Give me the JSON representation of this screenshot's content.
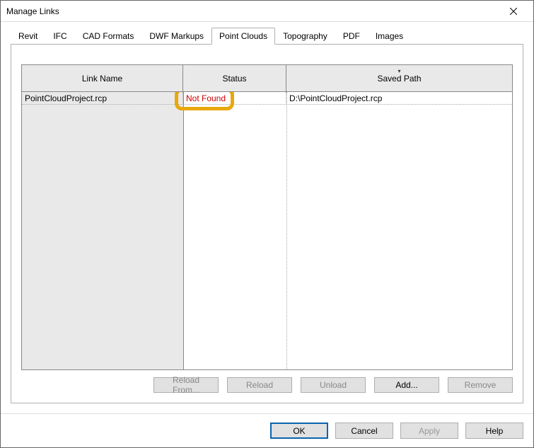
{
  "window": {
    "title": "Manage Links"
  },
  "tabs": {
    "items": [
      {
        "label": "Revit"
      },
      {
        "label": "IFC"
      },
      {
        "label": "CAD Formats"
      },
      {
        "label": "DWF Markups"
      },
      {
        "label": "Point Clouds"
      },
      {
        "label": "Topography"
      },
      {
        "label": "PDF"
      },
      {
        "label": "Images"
      }
    ],
    "active_index": 4
  },
  "grid": {
    "columns": {
      "name": "Link Name",
      "status": "Status",
      "path": "Saved Path"
    },
    "rows": [
      {
        "name": "PointCloudProject.rcp",
        "status": "Not Found",
        "path": "D:\\PointCloudProject.rcp",
        "status_error": true
      }
    ]
  },
  "panel_buttons": {
    "reload_from": "Reload From...",
    "reload": "Reload",
    "unload": "Unload",
    "add": "Add...",
    "remove": "Remove"
  },
  "footer_buttons": {
    "ok": "OK",
    "cancel": "Cancel",
    "apply": "Apply",
    "help": "Help"
  }
}
